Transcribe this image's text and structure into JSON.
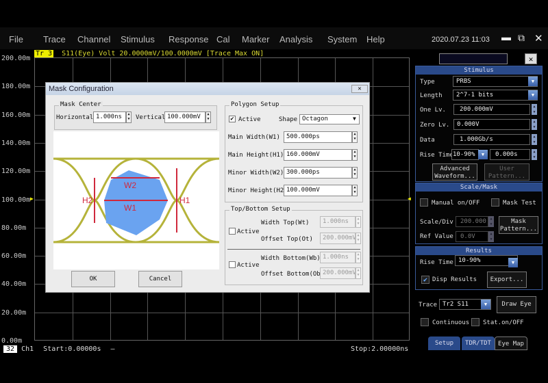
{
  "menu": [
    "File",
    "Trace",
    "Channel",
    "Stimulus",
    "Response",
    "Cal",
    "Marker",
    "Analysis",
    "System",
    "Help"
  ],
  "datetime": "2020.07.23 11:03",
  "window_icons": [
    "minimize-icon",
    "restore-icon",
    "close-icon"
  ],
  "trace_header": {
    "badge": "Tr 3",
    "text": "S11(Eye) Volt 20.0000mV/100.0000mV  [Trace Max ON]"
  },
  "y_axis": [
    "200.00m",
    "180.00m",
    "160.00m",
    "140.00m",
    "120.00m",
    "100.00m",
    "80.00m",
    "60.00m",
    "40.00m",
    "20.00m",
    "0.00m"
  ],
  "footer": {
    "num": "32",
    "channel": "Ch1",
    "start": "Start:0.00000s",
    "dash": "—",
    "stop": "Stop:2.00000ns"
  },
  "dialog": {
    "title": "Mask Configuration",
    "mask_center": {
      "title": "Mask Center",
      "h_label": "Horizontal",
      "h_value": "1.000ns",
      "v_label": "Vertical",
      "v_value": "100.000mV"
    },
    "diagram_labels": {
      "w1": "W1",
      "w2": "W2",
      "h1": "H1",
      "h2": "H2"
    },
    "colors": {
      "eye": "#b5b33a",
      "mask": "#6aa3f0",
      "arrow": "#d0283c"
    },
    "ok": "OK",
    "cancel": "Cancel",
    "polygon": {
      "title": "Polygon Setup",
      "active_label": "Active",
      "active": true,
      "shape_label": "Shape",
      "shape": "Octagon",
      "fields": [
        {
          "label": "Main Width(W1)",
          "value": "500.000ps"
        },
        {
          "label": "Main Height(H1)",
          "value": "160.000mV"
        },
        {
          "label": "Minor Width(W2)",
          "value": "300.000ps"
        },
        {
          "label": "Minor Height(H2)",
          "value": "100.000mV"
        }
      ]
    },
    "topbottom": {
      "title": "Top/Bottom Setup",
      "top": {
        "active_label": "Active",
        "active": false,
        "w_label": "Width Top(Wt)",
        "w_value": "1.000ns",
        "o_label": "Offset Top(Ot)",
        "o_value": "200.000mV"
      },
      "bottom": {
        "active_label": "Active",
        "active": false,
        "w_label": "Width Bottom(Wb)",
        "w_value": "1.000ns",
        "o_label": "Offset Bottom(Ob)",
        "o_value": "200.000mV"
      }
    }
  },
  "panel": {
    "stimulus": {
      "title": "Stimulus",
      "type_label": "Type",
      "type": "PRBS",
      "length_label": "Length",
      "length": "2^7-1 bits",
      "one_label": "One Lv.",
      "one": "200.000mV",
      "zero_label": "Zero Lv.",
      "zero": "0.000V",
      "data_label": "Data",
      "data": "1.000Gb/s",
      "rise_label": "Rise Time",
      "rise_mode": "10-90%",
      "rise": "0.000s",
      "adv": "Advanced Waveform...",
      "user": "User Pattern..."
    },
    "scale": {
      "title": "Scale/Mask",
      "manual": "Manual on/OFF",
      "mask_test": "Mask Test",
      "scale_label": "Scale/Div",
      "scale": "200.000",
      "ref_label": "Ref Value",
      "ref": "0.0V",
      "mask_pattern": "Mask Pattern..."
    },
    "results": {
      "title": "Results",
      "rise_label": "Rise Time",
      "rise": "10-90%",
      "disp": "Disp Results",
      "disp_checked": true,
      "export": "Export..."
    },
    "trace_label": "Trace",
    "trace": "Tr2 S11",
    "draw_eye": "Draw Eye",
    "continuous": "Continuous",
    "stat": "Stat.on/OFF",
    "tabs": [
      "Setup",
      "TDR/TDT",
      "Eye Map"
    ]
  }
}
